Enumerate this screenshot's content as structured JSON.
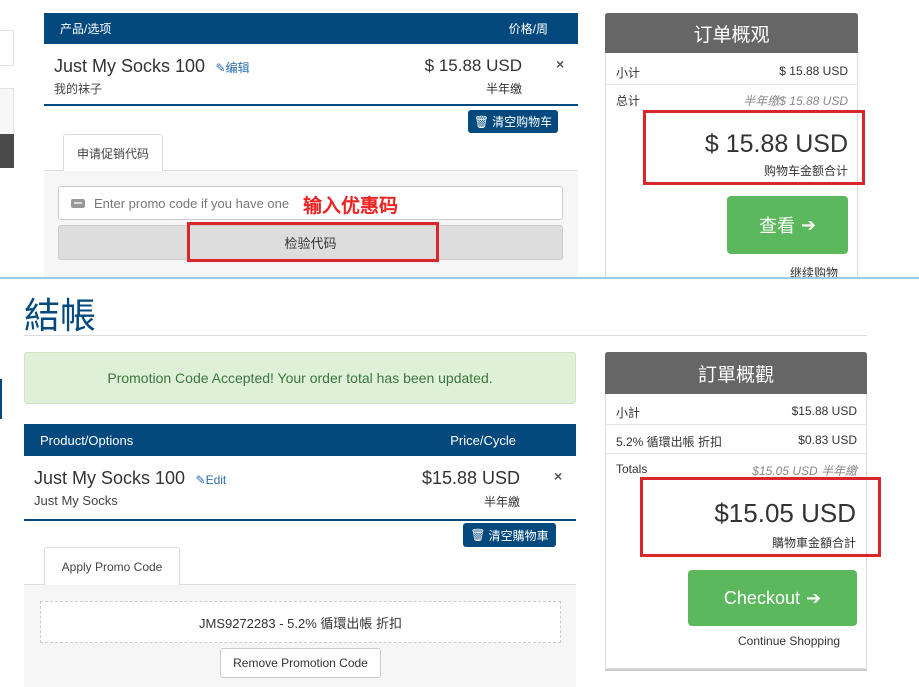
{
  "top": {
    "table_header": {
      "product_col": "产品/选项",
      "price_col": "价格/周"
    },
    "product": {
      "name": "Just My Socks 100",
      "edit_label": "编辑",
      "subtitle": "我的袜子",
      "price": "$ 15.88 USD",
      "cycle": "半年缴",
      "remove_symbol": "×"
    },
    "empty_cart_label": "清空购物车",
    "promo_tab_label": "申请促销代码",
    "promo_placeholder": "Enter promo code if you have one",
    "annotation": "输入优惠码",
    "validate_button": "检验代码",
    "summary": {
      "title": "订单概观",
      "subtotal_label": "小计",
      "subtotal_value": "$ 15.88 USD",
      "total_label": "总计",
      "total_value": "半年缴$ 15.88 USD",
      "grand_total": "$ 15.88 USD",
      "grand_total_label": "购物车金额合计",
      "checkout_label": "查看",
      "continue_label": "继续购物"
    }
  },
  "bottom": {
    "page_title": "結帳",
    "alert": "Promotion Code Accepted! Your order total has been updated.",
    "table_header": {
      "product_col": "Product/Options",
      "price_col": "Price/Cycle"
    },
    "product": {
      "name": "Just My Socks 100",
      "edit_label": "Edit",
      "subtitle": "Just My Socks",
      "price": "$15.88 USD",
      "cycle": "半年繳",
      "remove_symbol": "×"
    },
    "empty_cart_label": "清空購物車",
    "promo_tab_label": "Apply Promo Code",
    "applied_code": "JMS9272283 - 5.2% 循環出帳 折扣",
    "remove_promo_button": "Remove Promotion Code",
    "summary": {
      "title": "訂單概觀",
      "subtotal_label": "小計",
      "subtotal_value": "$15.88 USD",
      "discount_label": "5.2% 循環出帳 折扣",
      "discount_value": "$0.83 USD",
      "total_label": "Totals",
      "total_value": "$15.05 USD 半年繳",
      "grand_total": "$15.05 USD",
      "grand_total_label": "購物車金額合計",
      "checkout_label": "Checkout",
      "continue_label": "Continue Shopping"
    }
  },
  "colors": {
    "header_blue": "#03497e",
    "checkout_green": "#5cb85c",
    "highlight_red": "#d9262c",
    "summary_gray": "#666666",
    "alert_green_bg": "#dff0d8"
  }
}
